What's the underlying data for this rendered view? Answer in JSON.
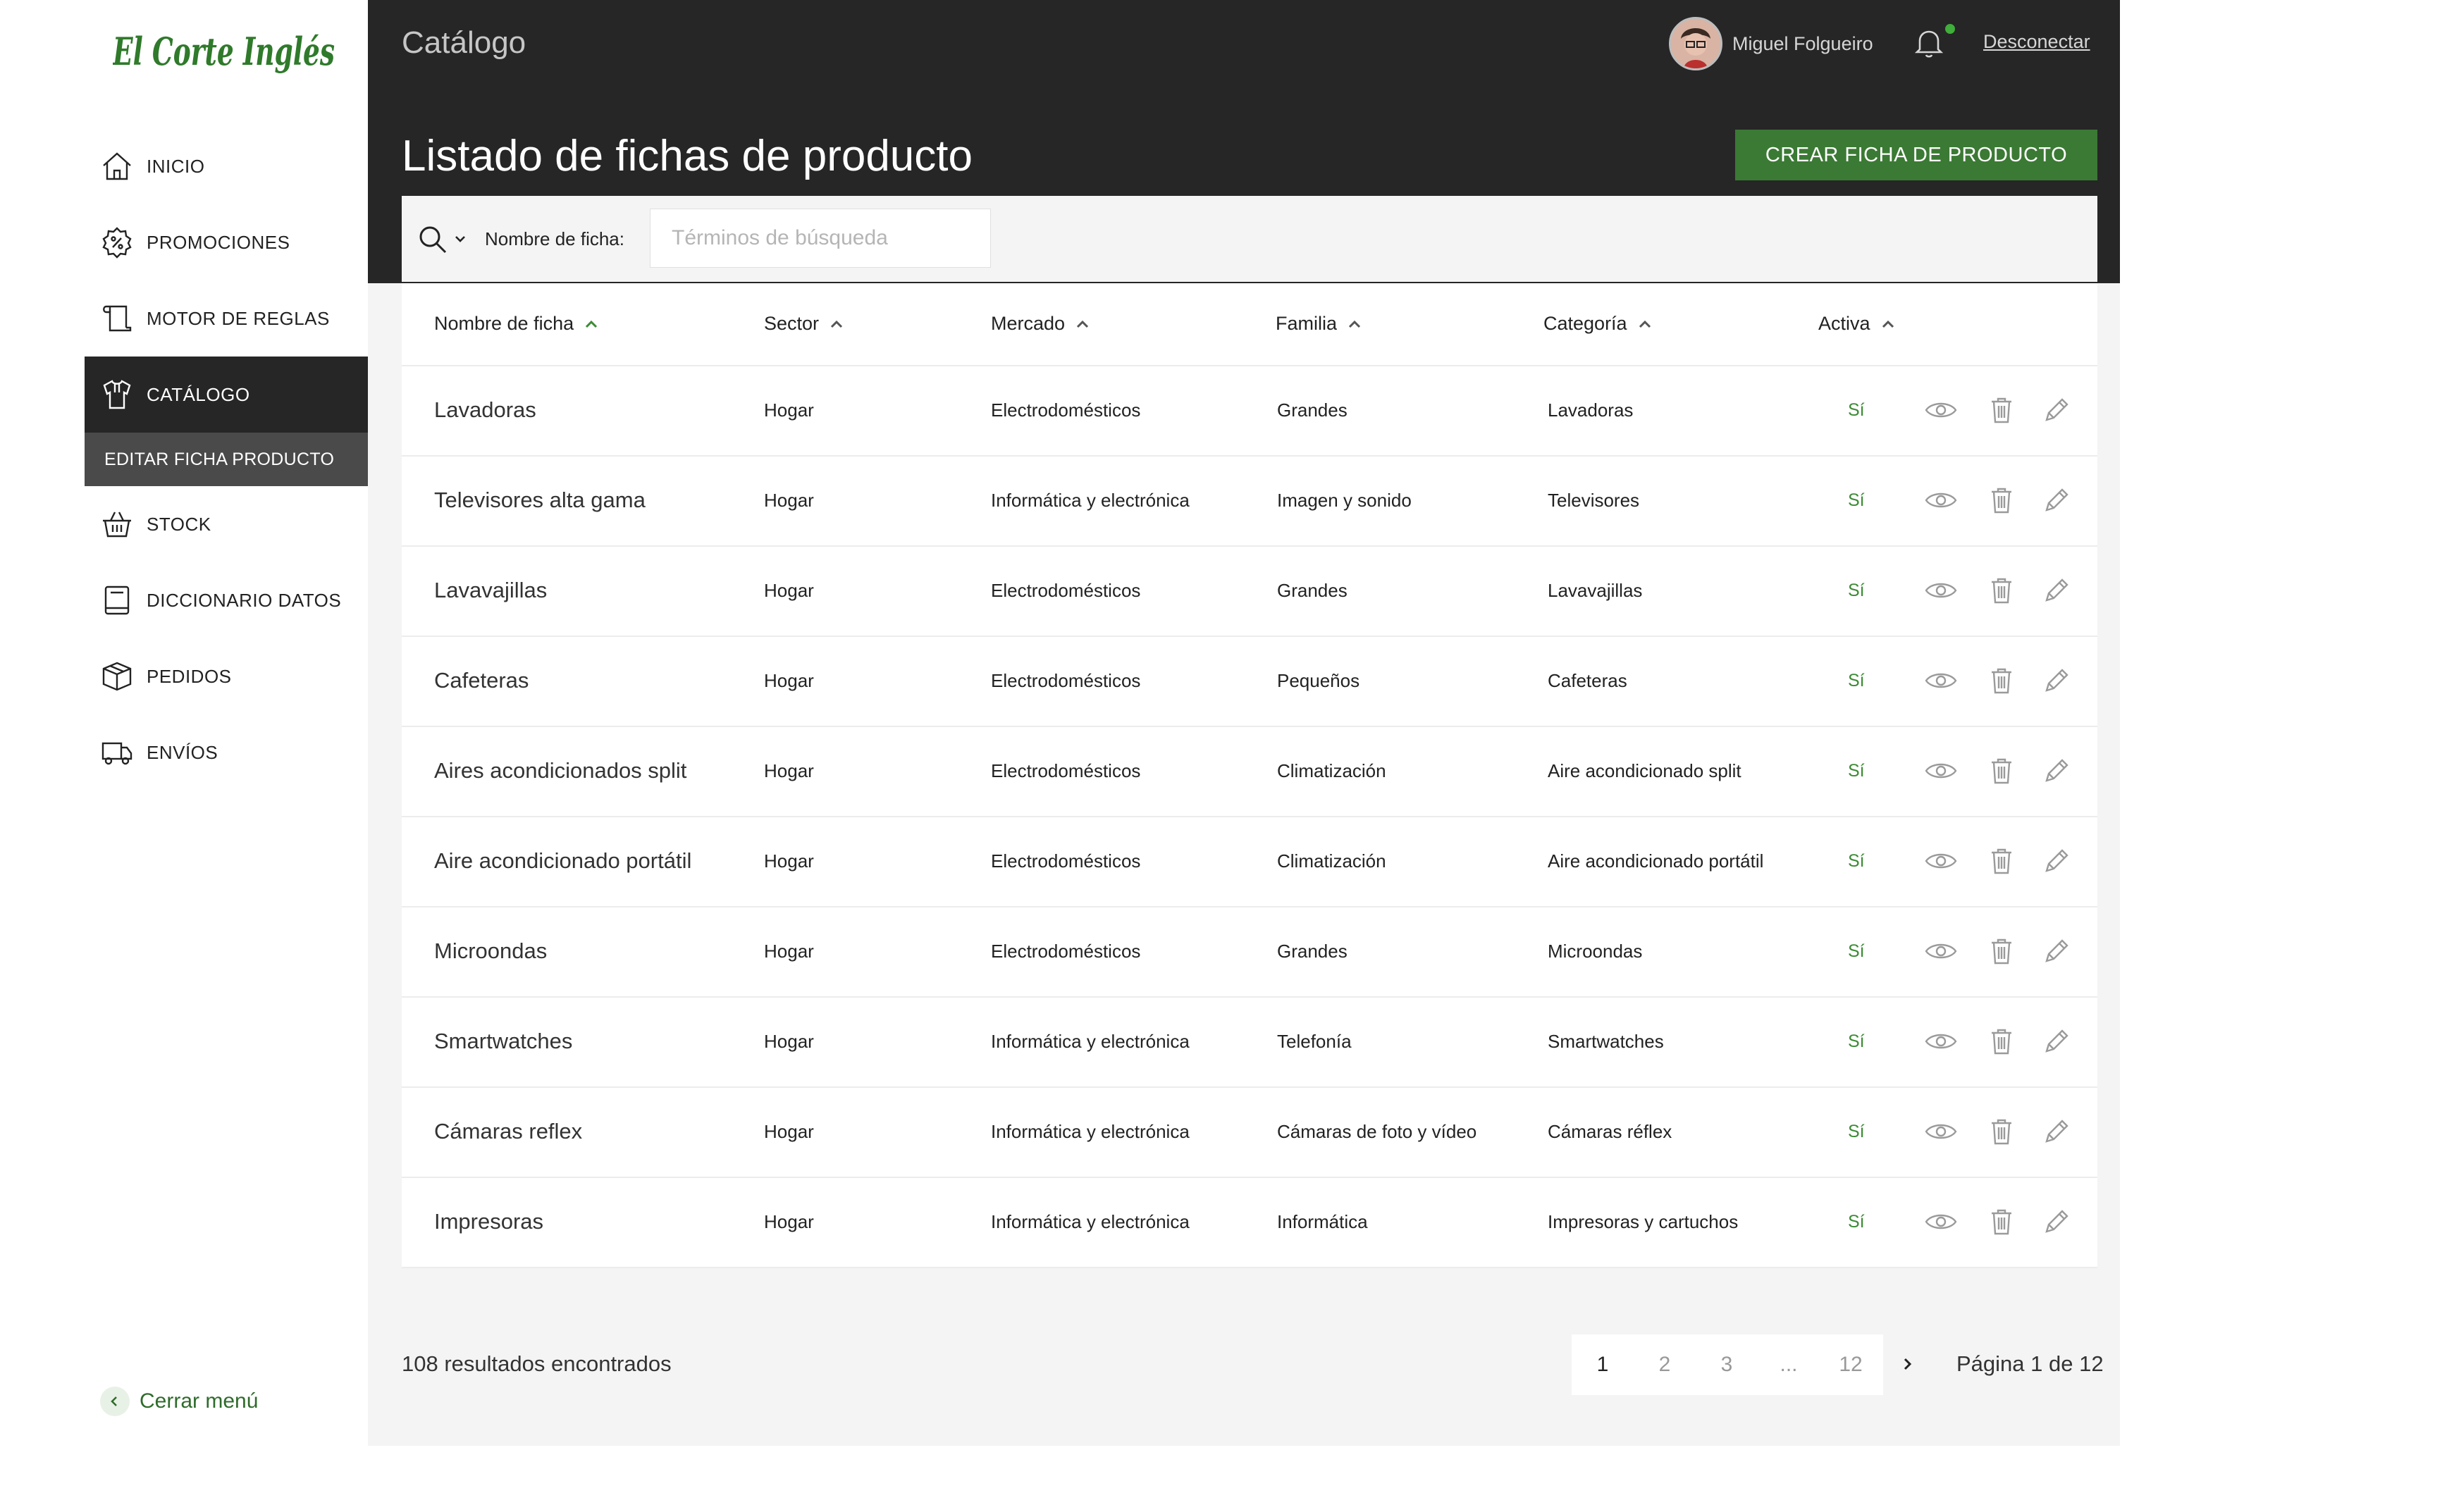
{
  "brand": {
    "logo_text": "El Corte Inglés",
    "accent": "#3b7a34"
  },
  "sidebar": {
    "items": [
      {
        "label": "INICIO",
        "icon": "home-icon"
      },
      {
        "label": "PROMOCIONES",
        "icon": "discount-badge-icon"
      },
      {
        "label": "MOTOR DE REGLAS",
        "icon": "scroll-icon"
      },
      {
        "label": "CATÁLOGO",
        "icon": "shirt-icon",
        "active": true
      },
      {
        "label": "STOCK",
        "icon": "basket-icon"
      },
      {
        "label": "DICCIONARIO DATOS",
        "icon": "book-icon"
      },
      {
        "label": "PEDIDOS",
        "icon": "box-icon"
      },
      {
        "label": "ENVÍOS",
        "icon": "truck-icon"
      }
    ],
    "subitem": "EDITAR FICHA PRODUCTO",
    "close_menu": "Cerrar menú"
  },
  "header": {
    "title": "Catálogo",
    "user_name": "Miguel Folgueiro",
    "logout": "Desconectar"
  },
  "main": {
    "page_title": "Listado de fichas de producto",
    "create_button": "CREAR FICHA DE PRODUCTO",
    "search": {
      "label": "Nombre de ficha:",
      "placeholder": "Términos de búsqueda",
      "value": ""
    }
  },
  "table": {
    "columns": [
      "Nombre de ficha",
      "Sector",
      "Mercado",
      "Familia",
      "Categoría",
      "Activa"
    ],
    "rows": [
      {
        "name": "Lavadoras",
        "sector": "Hogar",
        "mercado": "Electrodomésticos",
        "familia": "Grandes",
        "categoria": "Lavadoras",
        "activa": "Sí"
      },
      {
        "name": "Televisores alta gama",
        "sector": "Hogar",
        "mercado": "Informática y electrónica",
        "familia": "Imagen y sonido",
        "categoria": "Televisores",
        "activa": "Sí"
      },
      {
        "name": "Lavavajillas",
        "sector": "Hogar",
        "mercado": "Electrodomésticos",
        "familia": "Grandes",
        "categoria": "Lavavajillas",
        "activa": "Sí"
      },
      {
        "name": "Cafeteras",
        "sector": "Hogar",
        "mercado": "Electrodomésticos",
        "familia": "Pequeños",
        "categoria": "Cafeteras",
        "activa": "Sí"
      },
      {
        "name": "Aires acondicionados split",
        "sector": "Hogar",
        "mercado": "Electrodomésticos",
        "familia": "Climatización",
        "categoria": "Aire acondicionado split",
        "activa": "Sí"
      },
      {
        "name": "Aire acondicionado portátil",
        "sector": "Hogar",
        "mercado": "Electrodomésticos",
        "familia": "Climatización",
        "categoria": "Aire acondicionado portátil",
        "activa": "Sí"
      },
      {
        "name": "Microondas",
        "sector": "Hogar",
        "mercado": "Electrodomésticos",
        "familia": "Grandes",
        "categoria": "Microondas",
        "activa": "Sí"
      },
      {
        "name": "Smartwatches",
        "sector": "Hogar",
        "mercado": "Informática y electrónica",
        "familia": "Telefonía",
        "categoria": "Smartwatches",
        "activa": "Sí"
      },
      {
        "name": "Cámaras reflex",
        "sector": "Hogar",
        "mercado": "Informática y electrónica",
        "familia": "Cámaras de foto y vídeo",
        "categoria": "Cámaras réflex",
        "activa": "Sí"
      },
      {
        "name": "Impresoras",
        "sector": "Hogar",
        "mercado": "Informática y electrónica",
        "familia": "Informática",
        "categoria": "Impresoras y cartuchos",
        "activa": "Sí"
      }
    ]
  },
  "footer": {
    "results": "108 resultados encontrados",
    "pages": [
      "1",
      "2",
      "3",
      "...",
      "12"
    ],
    "current_page": "1",
    "page_info": "Página 1 de 12"
  }
}
